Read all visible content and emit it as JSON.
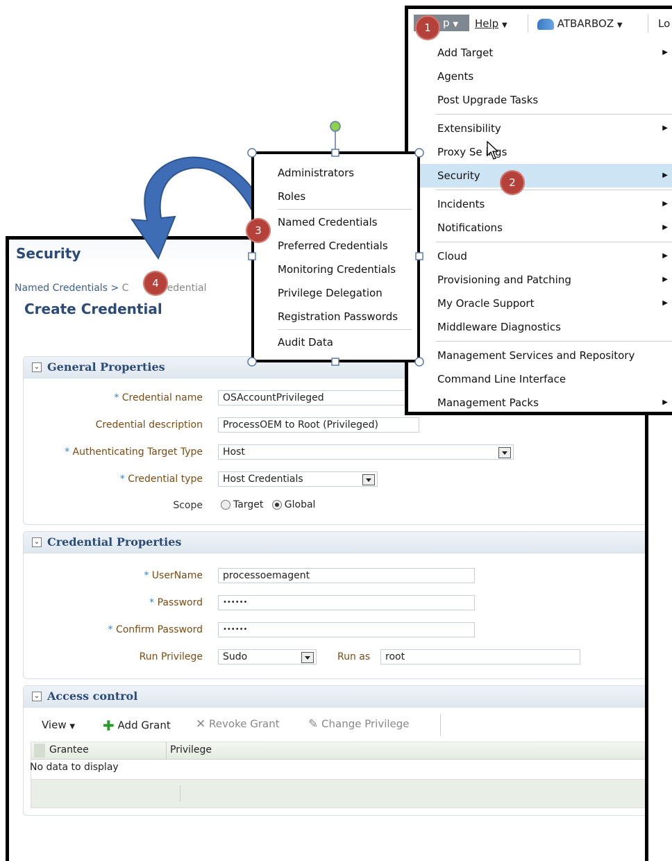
{
  "topbar": {
    "setup_fragment": "p",
    "help": "Help",
    "user": "ATBARBOZ",
    "logout_fragment": "Lo"
  },
  "setup_menu": [
    {
      "label": "Add Target",
      "submenu": true
    },
    {
      "label": "Agents",
      "submenu": false
    },
    {
      "label": "Post Upgrade Tasks",
      "submenu": false
    },
    {
      "label": "Extensibility",
      "submenu": true
    },
    {
      "label": "Proxy Se  ings",
      "submenu": false
    },
    {
      "label": "Security",
      "submenu": true
    },
    {
      "label": "Incidents",
      "submenu": true
    },
    {
      "label": "Notifications",
      "submenu": true
    },
    {
      "label": "Cloud",
      "submenu": true
    },
    {
      "label": "Provisioning and Patching",
      "submenu": true
    },
    {
      "label": "My Oracle Support",
      "submenu": true
    },
    {
      "label": "Middleware Diagnostics",
      "submenu": false
    },
    {
      "label": "Management Services and Repository",
      "submenu": false
    },
    {
      "label": "Command Line Interface",
      "submenu": false
    },
    {
      "label": "Management Packs",
      "submenu": true
    }
  ],
  "security_submenu": [
    "Administrators",
    "Roles",
    "Named Credentials",
    "Preferred Credentials",
    "Monitoring Credentials",
    "Privilege Delegation",
    "Registration Passwords",
    "Audit Data"
  ],
  "callouts": [
    "1",
    "2",
    "3",
    "4"
  ],
  "page": {
    "title": "Security",
    "breadcrumb_link": "Named Credentials",
    "breadcrumb_sep": ">",
    "breadcrumb_current_start": "C",
    "breadcrumb_current_end": "Credential",
    "heading": "Create Credential"
  },
  "general": {
    "title": "General Properties",
    "credential_name_label": "Credential name",
    "credential_name": "OSAccountPrivileged",
    "description_label": "Credential description",
    "description": "ProcessOEM to Root (Privileged)",
    "auth_target_label": "Authenticating Target Type",
    "auth_target": "Host",
    "cred_type_label": "Credential type",
    "cred_type": "Host Credentials",
    "scope_label": "Scope",
    "scope_target": "Target",
    "scope_global": "Global"
  },
  "credential": {
    "title": "Credential Properties",
    "username_label": "UserName",
    "username": "processoemagent",
    "password_label": "Password",
    "password": "••••••",
    "confirm_label": "Confirm Password",
    "confirm": "••••••",
    "run_priv_label": "Run Privilege",
    "run_priv": "Sudo",
    "run_as_label": "Run as",
    "run_as": "root"
  },
  "access": {
    "title": "Access control",
    "view": "View",
    "add_grant": "Add Grant",
    "revoke_grant": "Revoke Grant",
    "change_privilege": "Change Privilege",
    "col_grantee": "Grantee",
    "col_privilege": "Privilege",
    "empty": "No data to display"
  },
  "required_marker": "*"
}
